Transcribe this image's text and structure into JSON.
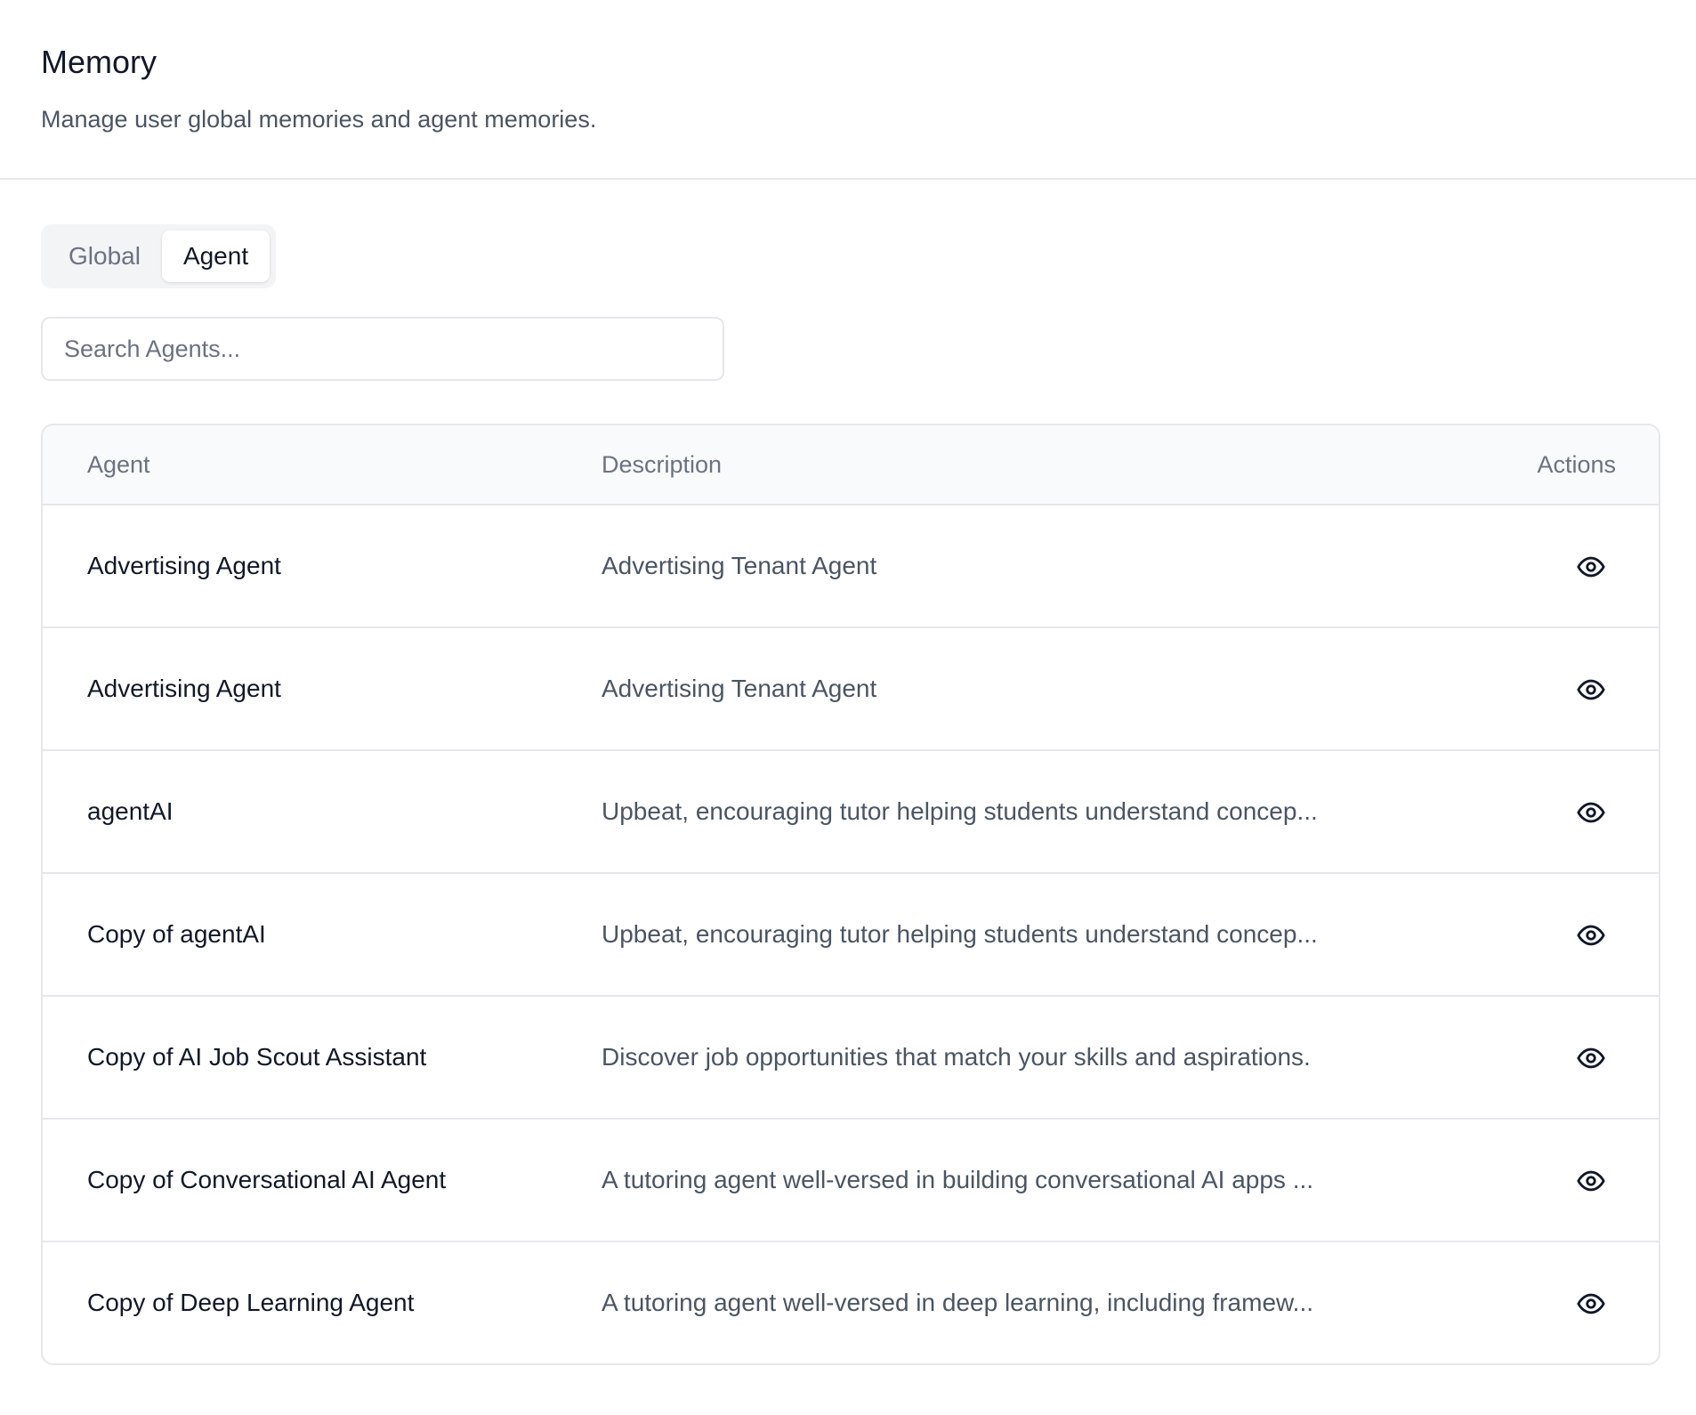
{
  "header": {
    "title": "Memory",
    "subtitle": "Manage user global memories and agent memories."
  },
  "tabs": [
    {
      "label": "Global",
      "active": false
    },
    {
      "label": "Agent",
      "active": true
    }
  ],
  "search": {
    "placeholder": "Search Agents...",
    "value": ""
  },
  "table": {
    "columns": {
      "agent": "Agent",
      "description": "Description",
      "actions": "Actions"
    },
    "rows": [
      {
        "name": "Advertising Agent",
        "description": "Advertising Tenant Agent",
        "action_icon": "eye-icon"
      },
      {
        "name": "Advertising Agent",
        "description": "Advertising Tenant Agent",
        "action_icon": "eye-icon"
      },
      {
        "name": "agentAI",
        "description": "Upbeat, encouraging tutor helping students understand concep...",
        "action_icon": "eye-icon"
      },
      {
        "name": "Copy of agentAI",
        "description": "Upbeat, encouraging tutor helping students understand concep...",
        "action_icon": "eye-icon"
      },
      {
        "name": "Copy of AI Job Scout Assistant",
        "description": "Discover job opportunities that match your skills and aspirations.",
        "action_icon": "eye-icon"
      },
      {
        "name": "Copy of Conversational AI Agent",
        "description": "A tutoring agent well-versed in building conversational AI apps ...",
        "action_icon": "eye-icon"
      },
      {
        "name": "Copy of Deep Learning Agent",
        "description": "A tutoring agent well-versed in deep learning, including framew...",
        "action_icon": "eye-icon"
      }
    ]
  },
  "colors": {
    "text_primary": "#111827",
    "text_secondary": "#4b5563",
    "text_muted": "#6b7280",
    "border": "#e5e7eb",
    "header_bg": "#f9fafb",
    "tab_track": "#f3f4f6"
  }
}
